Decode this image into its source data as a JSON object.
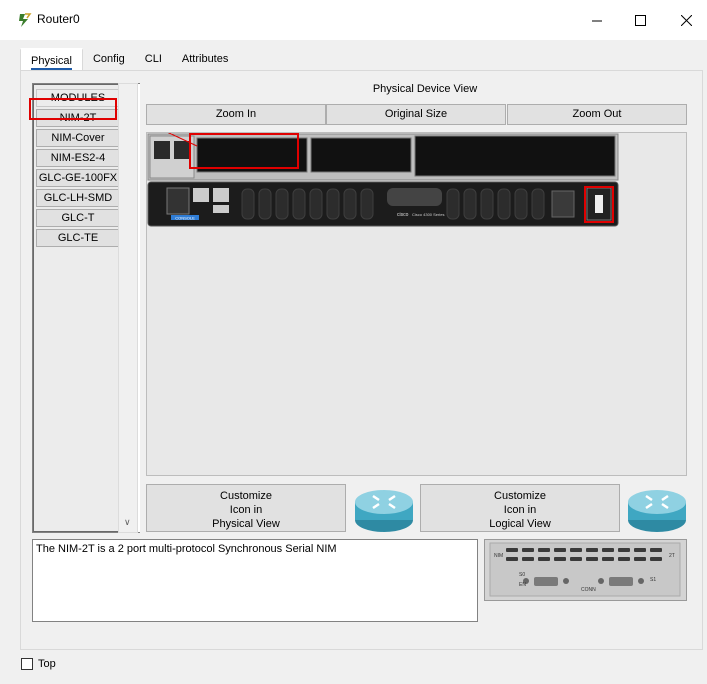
{
  "window": {
    "title": "Router0",
    "controls": {
      "minimize": "—",
      "maximize": "☐",
      "close": "✕"
    }
  },
  "tabs": [
    {
      "label": "Physical",
      "active": true
    },
    {
      "label": "Config",
      "active": false
    },
    {
      "label": "CLI",
      "active": false
    },
    {
      "label": "Attributes",
      "active": false
    }
  ],
  "modules": {
    "items": [
      "MODULES",
      "NIM-2T",
      "NIM-Cover",
      "NIM-ES2-4",
      "GLC-GE-100FX",
      "GLC-LH-SMD",
      "GLC-T",
      "GLC-TE"
    ],
    "selected": "NIM-2T"
  },
  "device_view": {
    "label": "Physical Device View",
    "zoom_in": "Zoom In",
    "original_size": "Original Size",
    "zoom_out": "Zoom Out",
    "router_brand": "cisco",
    "router_series": "Cisco 4300 Series",
    "router_console": "CONSOLE"
  },
  "customize": {
    "physical": [
      "Customize",
      "Icon in",
      "Physical View"
    ],
    "logical": [
      "Customize",
      "Icon in",
      "Logical View"
    ]
  },
  "description": "The NIM-2T is a 2 port multi-protocol Synchronous Serial NIM",
  "module_image": {
    "label_nim": "NIM",
    "label_2t": "2T",
    "label_conn": "CONN",
    "label_s0": "S0",
    "label_s1": "S1",
    "label_en": "EN"
  },
  "top_checkbox": {
    "label": "Top",
    "checked": false
  },
  "colors": {
    "highlight": "#e00000",
    "accent": "#1e5ba8",
    "router_body": "#1c1c1c"
  }
}
